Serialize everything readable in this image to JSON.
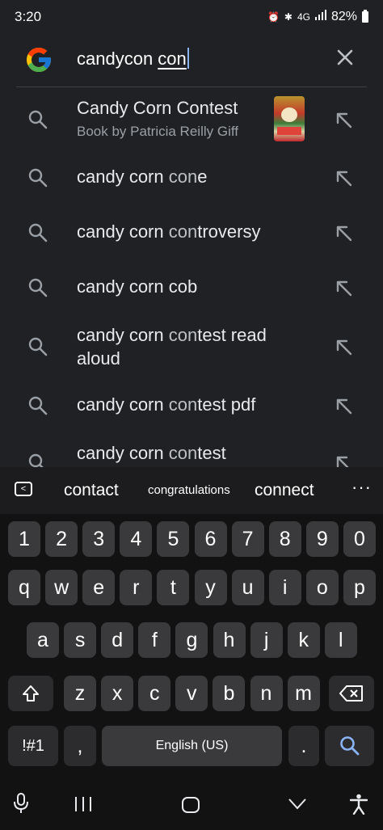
{
  "status": {
    "time": "3:20",
    "network": "4G",
    "battery": "82%"
  },
  "search": {
    "query_prefix": "candycon ",
    "query_typed": "con"
  },
  "suggestions": [
    {
      "prefix": "Candy Corn Contest",
      "typed": "",
      "suffix": "",
      "sub": "Book by Patricia Reilly Giff",
      "has_thumb": true
    },
    {
      "prefix": "candy corn ",
      "typed": "con",
      "suffix": "e"
    },
    {
      "prefix": "candy corn ",
      "typed": "con",
      "suffix": "troversy"
    },
    {
      "prefix": "candy corn cob",
      "typed": "",
      "suffix": ""
    },
    {
      "prefix": "candy corn ",
      "typed": "con",
      "suffix": "test read aloud"
    },
    {
      "prefix": "candy corn ",
      "typed": "con",
      "suffix": "test pdf"
    },
    {
      "prefix": "candy corn ",
      "typed": "con",
      "suffix": "test"
    }
  ],
  "keyboard": {
    "predictions": [
      "contact",
      "congratulations",
      "connect"
    ],
    "row_numbers": [
      "1",
      "2",
      "3",
      "4",
      "5",
      "6",
      "7",
      "8",
      "9",
      "0"
    ],
    "row_top": [
      "q",
      "w",
      "e",
      "r",
      "t",
      "y",
      "u",
      "i",
      "o",
      "p"
    ],
    "row_home": [
      "a",
      "s",
      "d",
      "f",
      "g",
      "h",
      "j",
      "k",
      "l"
    ],
    "row_bottom": [
      "z",
      "x",
      "c",
      "v",
      "b",
      "n",
      "m"
    ],
    "symbols_label": "!#1",
    "comma_label": ",",
    "space_label": "English (US)",
    "period_label": "."
  },
  "colors": {
    "background": "#202124",
    "keyboard_bg": "#121212",
    "key_bg": "#3a3a3c",
    "accent": "#8ab4f8"
  }
}
